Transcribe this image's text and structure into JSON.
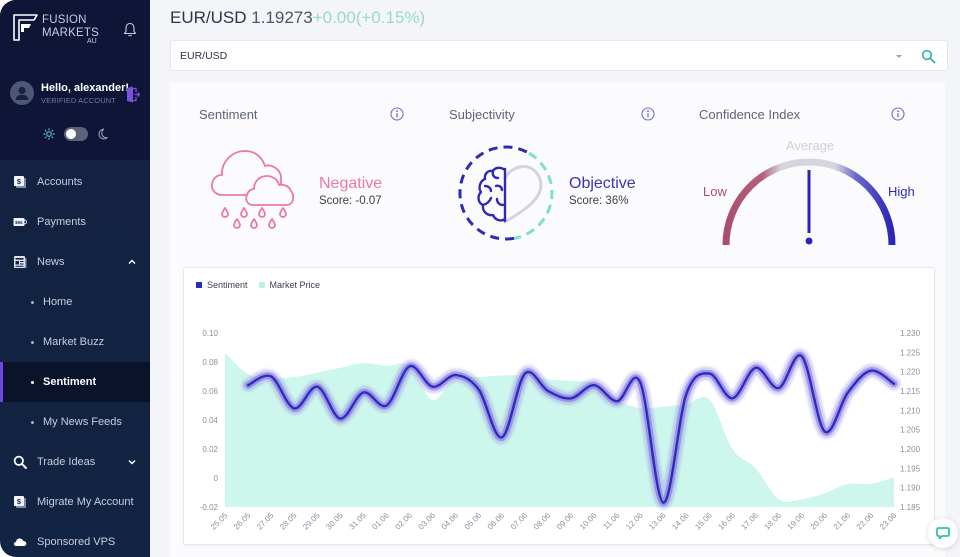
{
  "brand": {
    "line1": "FUSION",
    "line2": "MARKETS",
    "region": "AU"
  },
  "user": {
    "greeting": "Hello, alexander!",
    "status": "VERIFIED ACCOUNT"
  },
  "theme": {
    "current": "light"
  },
  "sidebar": {
    "items": [
      {
        "label": "Accounts",
        "icon": "dollar-card-icon"
      },
      {
        "label": "Payments",
        "icon": "payment-card-icon"
      },
      {
        "label": "News",
        "icon": "newspaper-icon",
        "expanded": true,
        "children": [
          {
            "label": "Home"
          },
          {
            "label": "Market Buzz"
          },
          {
            "label": "Sentiment",
            "active": true
          },
          {
            "label": "My News Feeds"
          }
        ]
      },
      {
        "label": "Trade Ideas",
        "icon": "search-icon",
        "expanded": false
      },
      {
        "label": "Migrate My Account",
        "icon": "dollar-card-icon"
      },
      {
        "label": "Sponsored VPS",
        "icon": "cloud-icon"
      }
    ]
  },
  "header": {
    "symbol": "EUR/USD",
    "price": "1.19273",
    "change": "+0.00(+0.15%)"
  },
  "search": {
    "value": "EUR/USD"
  },
  "cards": {
    "sentiment": {
      "title": "Sentiment",
      "label": "Negative",
      "score": "Score: -0.07",
      "icon": "rain-cloud-icon"
    },
    "subjectivity": {
      "title": "Subjectivity",
      "label": "Objective",
      "score": "Score: 36%",
      "icon": "brain-heart-icon"
    },
    "confidence": {
      "title": "Confidence Index",
      "low": "Low",
      "average": "Average",
      "high": "High",
      "level": "Average",
      "level_fraction": 0.5
    }
  },
  "colors": {
    "negative": "#e97aa2",
    "objective": "#3a33b8",
    "sentiment_line": "#3329c2",
    "market_area": "#cdf7ec",
    "price_change": "#96dcc4",
    "gauge_low": "#a94f6e",
    "gauge_high": "#2d28b8",
    "search_icon": "#2fb5a5"
  },
  "chart_data": {
    "type": "line",
    "title": "",
    "legend_position": "top-left",
    "grid": false,
    "categories": [
      "25.05",
      "26.05",
      "27.05",
      "28.05",
      "29.05",
      "30.05",
      "31.05",
      "01.06",
      "02.06",
      "03.06",
      "04.06",
      "05.06",
      "06.06",
      "07.06",
      "08.06",
      "09.06",
      "10.06",
      "11.06",
      "12.06",
      "13.06",
      "14.06",
      "15.06",
      "16.06",
      "17.06",
      "18.06",
      "19.06",
      "20.06",
      "21.06",
      "22.06",
      "23.06"
    ],
    "series": [
      {
        "name": "Sentiment",
        "kind": "line",
        "axis": "left",
        "color": "#3329c2",
        "values": [
          null,
          0.064,
          0.07,
          0.048,
          0.063,
          0.041,
          0.059,
          0.05,
          0.077,
          0.063,
          0.071,
          0.061,
          0.028,
          0.072,
          0.06,
          0.055,
          0.064,
          0.053,
          0.066,
          -0.017,
          0.058,
          0.072,
          0.055,
          0.076,
          0.062,
          0.084,
          0.032,
          0.059,
          0.074,
          0.065
        ]
      },
      {
        "name": "Market Price",
        "kind": "area",
        "axis": "right",
        "color": "#cdf7ec",
        "values": [
          1.2248,
          1.2194,
          1.2184,
          1.2186,
          1.2197,
          1.221,
          1.2222,
          1.2215,
          1.2215,
          1.2127,
          1.2185,
          1.2186,
          1.219,
          1.219,
          1.218,
          1.2176,
          1.217,
          1.2125,
          1.2106,
          1.211,
          1.2116,
          1.2128,
          1.2,
          1.195,
          1.187,
          1.187,
          1.1886,
          1.191,
          1.191,
          1.1927
        ]
      }
    ],
    "y_left": {
      "label": "",
      "min": -0.02,
      "max": 0.1,
      "ticks": [
        0.1,
        0.08,
        0.06,
        0.04,
        0.02,
        0,
        -0.02
      ],
      "tick_labels": [
        "0.10",
        "0.08",
        "0.06",
        "0.04",
        "0.02",
        "0",
        "-0.02"
      ]
    },
    "y_right": {
      "label": "",
      "min": 1.185,
      "max": 1.23,
      "ticks": [
        1.23,
        1.225,
        1.22,
        1.215,
        1.21,
        1.205,
        1.2,
        1.195,
        1.19,
        1.185
      ],
      "tick_labels": [
        "1.230",
        "1.225",
        "1.220",
        "1.215",
        "1.210",
        "1.205",
        "1.200",
        "1.195",
        "1.190",
        "1.185"
      ]
    },
    "xlabel": ""
  }
}
